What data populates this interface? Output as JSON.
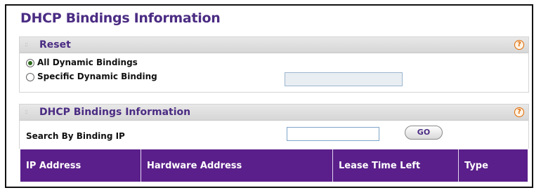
{
  "page_title": "DHCP Bindings Information",
  "reset_panel": {
    "title": "Reset",
    "help": "?",
    "option_all": "All Dynamic Bindings",
    "option_specific": "Specific Dynamic Binding",
    "specific_value": "",
    "selected": "All Dynamic Bindings"
  },
  "info_panel": {
    "title": "DHCP Bindings Information",
    "help": "?",
    "search_label": "Search By Binding IP",
    "search_value": "",
    "go_label": "GO"
  },
  "table": {
    "columns": [
      "IP Address",
      "Hardware Address",
      "Lease Time Left",
      "Type"
    ]
  },
  "colors": {
    "title": "#4b2c83",
    "table_header_bg": "#5a1f8a",
    "help_icon": "#e06a00"
  },
  "icons": [
    "grip-icon",
    "help-icon"
  ]
}
